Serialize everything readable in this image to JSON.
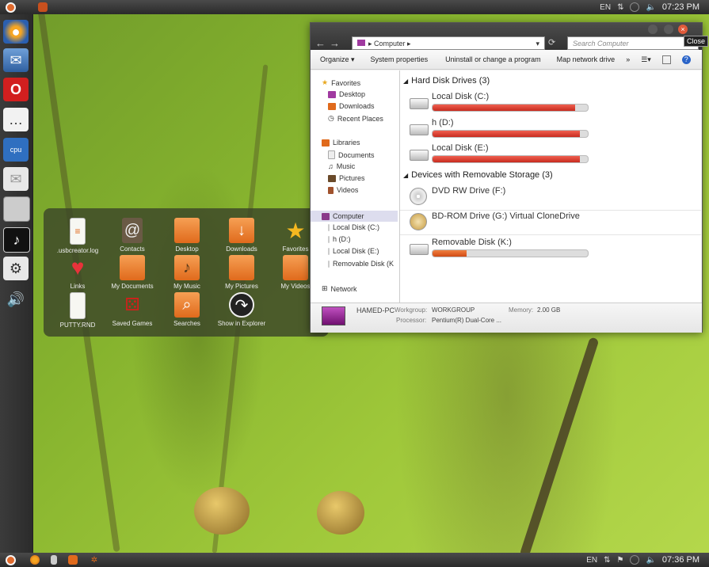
{
  "top_panel": {
    "lang": "EN",
    "time": "07:23 PM"
  },
  "bottom_panel": {
    "lang": "EN",
    "time": "07:36 PM"
  },
  "launcher": [
    "firefox-icon",
    "thunderbird-icon",
    "opera-icon",
    "chat-icon",
    "cpu-monitor-icon",
    "mail-icon",
    "display-icon",
    "music-icon",
    "control-panel-icon",
    "volume-icon"
  ],
  "places": [
    {
      "label": ".usbcreator.log",
      "icon": "log-file-icon"
    },
    {
      "label": "Contacts",
      "icon": "contacts-icon"
    },
    {
      "label": "Desktop",
      "icon": "desktop-folder-icon"
    },
    {
      "label": "Downloads",
      "icon": "downloads-folder-icon"
    },
    {
      "label": "Favorites",
      "icon": "favorites-star-icon"
    },
    {
      "label": "Links",
      "icon": "links-heart-icon"
    },
    {
      "label": "My Documents",
      "icon": "documents-folder-icon"
    },
    {
      "label": "My Music",
      "icon": "music-folder-icon"
    },
    {
      "label": "My Pictures",
      "icon": "pictures-folder-icon"
    },
    {
      "label": "My Videos",
      "icon": "videos-folder-icon"
    },
    {
      "label": "PUTTY.RND",
      "icon": "file-icon"
    },
    {
      "label": "Saved Games",
      "icon": "dice-icon"
    },
    {
      "label": "Searches",
      "icon": "search-folder-icon"
    },
    {
      "label": "Show in Explorer",
      "icon": "arrow-circle-icon"
    }
  ],
  "explorer": {
    "address": "Computer",
    "search_placeholder": "Search Computer",
    "close_tooltip": "Close",
    "toolbar": [
      "Organize ▾",
      "System properties",
      "Uninstall or change a program",
      "Map network drive",
      "»"
    ],
    "nav": {
      "favorites": "Favorites",
      "desktop": "Desktop",
      "downloads": "Downloads",
      "recent": "Recent Places",
      "libraries": "Libraries",
      "documents": "Documents",
      "music": "Music",
      "pictures": "Pictures",
      "videos": "Videos",
      "computer": "Computer",
      "c": "Local Disk (C:)",
      "d": "h (D:)",
      "e": "Local Disk (E:)",
      "k": "Removable Disk (K",
      "network": "Network"
    },
    "groups": {
      "hdd": "Hard Disk Drives (3)",
      "removable": "Devices with Removable Storage (3)"
    },
    "drives": {
      "c": {
        "name": "Local Disk (C:)",
        "used_fraction": 0.92
      },
      "d": {
        "name": "h (D:)",
        "used_fraction": 0.95
      },
      "e": {
        "name": "Local Disk (E:)",
        "used_fraction": 0.95
      },
      "f": {
        "name": "DVD RW Drive (F:)"
      },
      "g": {
        "name": "BD-ROM Drive (G:) Virtual CloneDrive"
      },
      "k": {
        "name": "Removable Disk (K:)",
        "used_fraction": 0.22
      }
    },
    "details": {
      "pc_name": "HAMED-PC",
      "workgroup_label": "Workgroup:",
      "workgroup": "WORKGROUP",
      "memory_label": "Memory:",
      "memory": "2.00 GB",
      "processor_label": "Processor:",
      "processor": "Pentium(R) Dual-Core ..."
    }
  }
}
